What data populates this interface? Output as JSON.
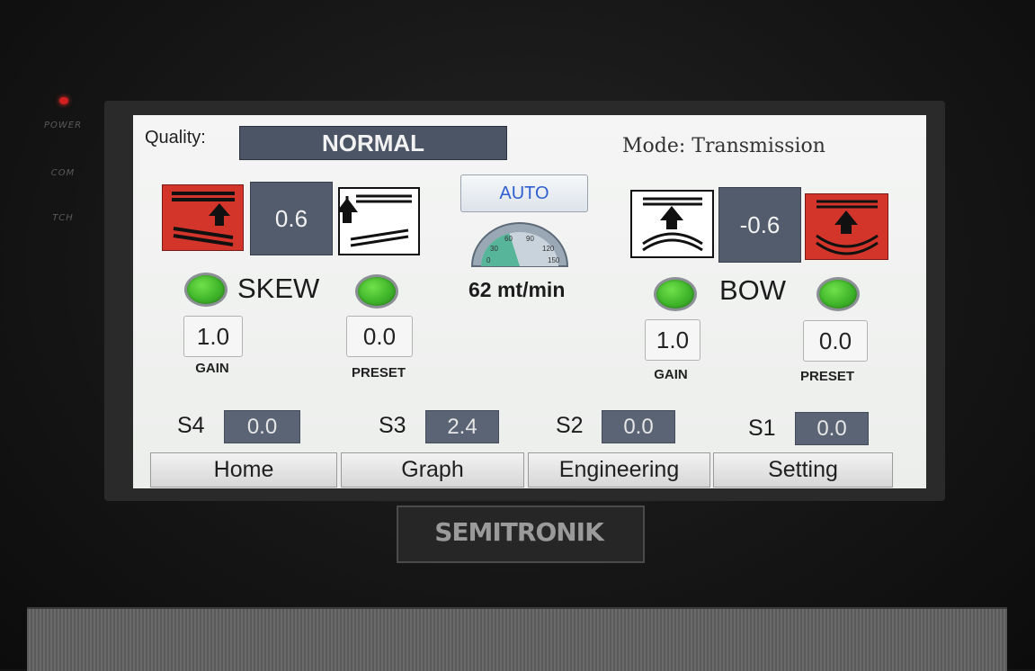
{
  "device": {
    "side_labels": [
      "POWER",
      "COM",
      "TCH"
    ],
    "brand": "SEMITRONIK"
  },
  "header": {
    "quality_label": "Quality:",
    "quality_value": "NORMAL",
    "mode_label": "Mode: Transmission"
  },
  "center": {
    "auto_label": "AUTO",
    "gauge_ticks": [
      "0",
      "30",
      "60",
      "90",
      "120",
      "150"
    ],
    "speed": "62 mt/min"
  },
  "skew": {
    "label": "SKEW",
    "value": "0.6",
    "gain_value": "1.0",
    "gain_label": "GAIN",
    "preset_value": "0.0",
    "preset_label": "PRESET"
  },
  "bow": {
    "label": "BOW",
    "value": "-0.6",
    "gain_value": "1.0",
    "gain_label": "GAIN",
    "preset_value": "0.0",
    "preset_label": "PRESET"
  },
  "sensors": [
    {
      "label": "S4",
      "value": "0.0"
    },
    {
      "label": "S3",
      "value": "2.4"
    },
    {
      "label": "S2",
      "value": "0.0"
    },
    {
      "label": "S1",
      "value": "0.0"
    }
  ],
  "nav": {
    "home": "Home",
    "graph": "Graph",
    "engineering": "Engineering",
    "setting": "Setting"
  },
  "colors": {
    "led_on": "#3fb52a",
    "motor_active": "#d4352b",
    "value_box": "#535c6c",
    "auto_text": "#2f5fd0"
  },
  "gauge": {
    "value": 62,
    "max": 150
  }
}
